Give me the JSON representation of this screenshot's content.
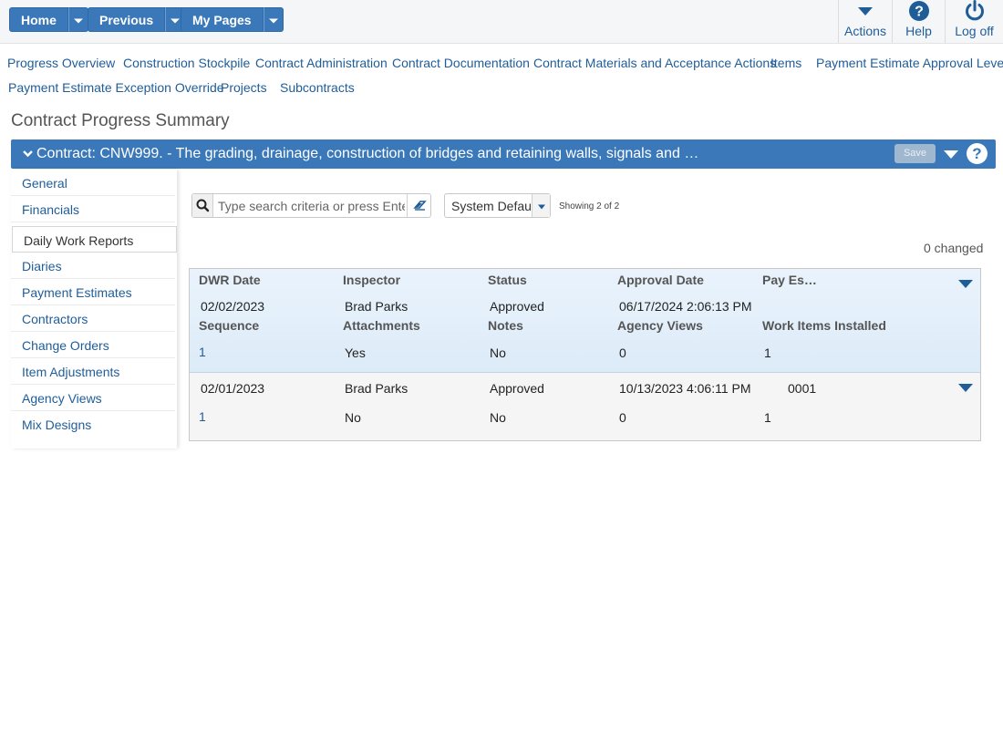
{
  "topbar": {
    "home_label": "Home",
    "previous_label": "Previous",
    "mypages_label": "My Pages",
    "actions_label": "Actions",
    "help_label": "Help",
    "logoff_label": "Log off"
  },
  "links": [
    "Progress Overview",
    "Construction Stockpile",
    "Contract Administration",
    "Contract Documentation",
    "Contract Materials and Acceptance Actions",
    "Items",
    "Payment Estimate Approval Levels",
    "Payment Estimate Exception Override",
    "Projects",
    "Subcontracts"
  ],
  "page_title": "Contract Progress Summary",
  "banner": {
    "text": "Contract: CNW999. - The grading, drainage, construction of bridges and retaining walls, signals and …",
    "save_label": "Save",
    "help_glyph": "?"
  },
  "sidenav": [
    "General",
    "Financials",
    "Daily Work Reports",
    "Diaries",
    "Payment Estimates",
    "Contractors",
    "Change Orders",
    "Item Adjustments",
    "Agency Views",
    "Mix Designs"
  ],
  "search": {
    "placeholder": "Type search criteria or press Enter"
  },
  "view_select": {
    "value": "System Default"
  },
  "showing": "Showing 2 of 2",
  "changed": "0 changed",
  "table": {
    "headers_top": [
      "DWR Date",
      "Inspector",
      "Status",
      "Approval Date",
      "Pay Es…"
    ],
    "headers_bottom": [
      "Sequence",
      "Attachments",
      "Notes",
      "Agency Views",
      "Work Items Installed"
    ],
    "rows": [
      {
        "dwr_date": "02/02/2023",
        "inspector": "Brad Parks",
        "status": "Approved",
        "approval_date": "06/17/2024 2:06:13 PM",
        "pay_est": "",
        "sequence": "1",
        "attachments": "Yes",
        "notes": "No",
        "agency_views": "0",
        "work_items": "1"
      },
      {
        "dwr_date": "02/01/2023",
        "inspector": "Brad Parks",
        "status": "Approved",
        "approval_date": "10/13/2023 4:06:11 PM",
        "pay_est": "0001",
        "sequence": "1",
        "attachments": "No",
        "notes": "No",
        "agency_views": "0",
        "work_items": "1"
      }
    ]
  },
  "colors": {
    "primary": "#3a78b9",
    "link": "#1f5d99"
  }
}
